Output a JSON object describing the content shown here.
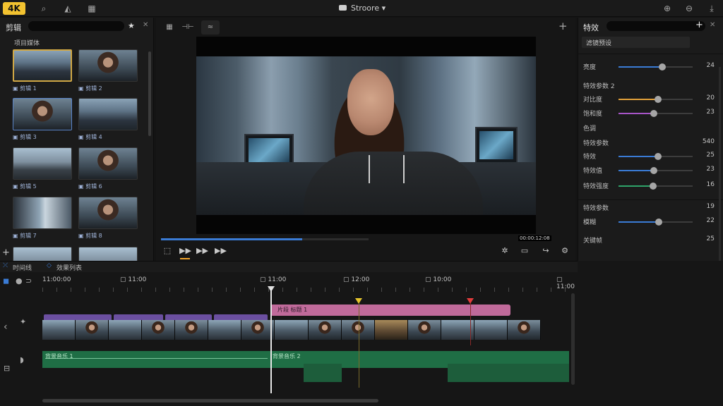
{
  "app": {
    "logo": "4K",
    "title": "Stroore"
  },
  "left_panel": {
    "title": "剪辑",
    "category": "项目媒体",
    "clips": [
      {
        "label": "▣ 剪辑 1",
        "kind": "office",
        "selected": true
      },
      {
        "label": "▣ 剪辑 2",
        "kind": "woman"
      },
      {
        "label": "▣ 剪辑 3",
        "kind": "woman",
        "focused": true
      },
      {
        "label": "▣ 剪辑 4",
        "kind": "office"
      },
      {
        "label": "▣ 剪辑 5",
        "kind": "city"
      },
      {
        "label": "▣ 剪辑 6",
        "kind": "woman"
      },
      {
        "label": "▣ 剪辑 7",
        "kind": "window"
      },
      {
        "label": "▣ 剪辑 8",
        "kind": "woman"
      }
    ]
  },
  "viewer": {
    "timecode": "00:00:12:08",
    "progress": 0.68
  },
  "right_panel": {
    "title": "特效",
    "preset": "滤镜预设",
    "rows": [
      {
        "label": "亮度",
        "value": "24",
        "fill": 0.59,
        "color": "#3a7bd5"
      },
      {
        "section": "特效参数 2"
      },
      {
        "label": "对比度",
        "value": "20",
        "fill": 0.53,
        "color": "#e3a23a"
      },
      {
        "label": "饱和度",
        "value": "23",
        "fill": 0.48,
        "color": "#a855c8"
      },
      {
        "section": "色调"
      },
      {
        "section": "特效参数",
        "value": "540"
      },
      {
        "label": "特效",
        "value": "25",
        "fill": 0.53,
        "color": "#3a7bd5"
      },
      {
        "label": "特效值",
        "value": "23",
        "fill": 0.48,
        "color": "#3a7bd5"
      },
      {
        "label": "特效强度",
        "value": "16",
        "fill": 0.47,
        "color": "#2fa36a"
      },
      {
        "section": "特效参数",
        "value": "19"
      },
      {
        "label": "模糊",
        "value": "22",
        "fill": 0.54,
        "color": "#3a7bd5"
      },
      {
        "section": "关键帧",
        "value": "25"
      }
    ]
  },
  "timeline": {
    "tabs": [
      "时间线",
      "效果列表"
    ],
    "ruler": [
      "11:00:00",
      "11:00",
      "11:00",
      "12:00",
      "10:00",
      "11:00"
    ],
    "clip_label": "片段 标题 1",
    "audio_label_1": "背景音乐 1",
    "audio_label_2": "背景音乐 2",
    "marker_colors": {
      "yellow": "#e5c52d",
      "red": "#e23c3c"
    }
  }
}
